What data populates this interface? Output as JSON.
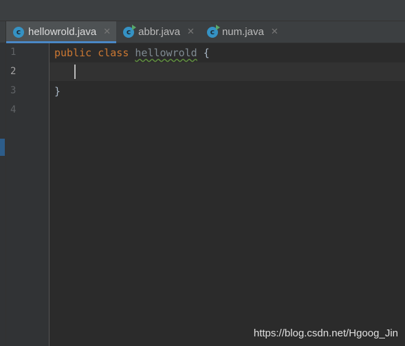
{
  "tabs": [
    {
      "label": "hellowrold.java",
      "active": true,
      "run_badge": false
    },
    {
      "label": "abbr.java",
      "active": false,
      "run_badge": true
    },
    {
      "label": "num.java",
      "active": false,
      "run_badge": true
    }
  ],
  "icons": {
    "class_file": "java-class-icon",
    "close": "close-icon"
  },
  "gutter": {
    "line_numbers": [
      "1",
      "2",
      "3",
      "4"
    ],
    "current_line": "2"
  },
  "code": {
    "line1": {
      "kw1": "public",
      "kw2": "class",
      "class_name": "hellowrold",
      "brace": "{"
    },
    "line3": {
      "brace": "}"
    }
  },
  "watermark": "https://blog.csdn.net/Hgoog_Jin",
  "colors": {
    "keyword": "#cc7832",
    "accent": "#4a88c7",
    "background": "#2b2b2b"
  }
}
